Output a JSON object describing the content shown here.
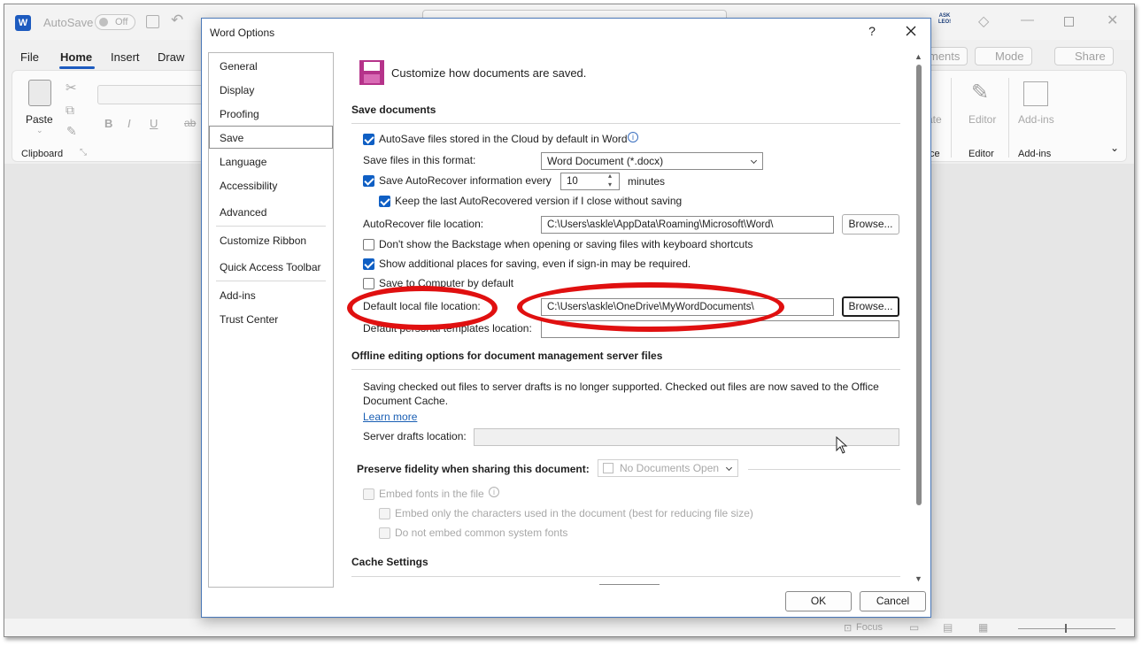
{
  "app": {
    "autosave_label": "AutoSave",
    "autosave_toggle": "Off",
    "ribbon_tabs": [
      "File",
      "Home",
      "Insert",
      "Draw"
    ],
    "active_tab": "Home",
    "clipboard": {
      "paste_label": "Paste",
      "group_label": "Clipboard"
    },
    "font_buttons": [
      "B",
      "I",
      "U",
      "ab"
    ],
    "right_buttons": {
      "comments": "ments",
      "mode": "Mode",
      "share": "Share"
    },
    "right_groups": [
      {
        "icon": "editor-icon",
        "label": "Editor",
        "group": "Editor"
      },
      {
        "icon": "addins-icon",
        "label": "Add-ins",
        "group": "Add-ins"
      }
    ],
    "partial_group": "ce",
    "partial_group_top": "ate",
    "status": {
      "focus": "Focus"
    },
    "logo_text": "ASK LEO!"
  },
  "dialog": {
    "title": "Word Options",
    "help": "?",
    "nav": [
      "General",
      "Display",
      "Proofing",
      "Save",
      "Language",
      "Accessibility",
      "Advanced",
      "Customize Ribbon",
      "Quick Access Toolbar",
      "Add-ins",
      "Trust Center"
    ],
    "selected_nav": "Save",
    "header": "Customize how documents are saved.",
    "save_section": {
      "title": "Save documents",
      "autosave_cloud": {
        "label": "AutoSave files stored in the Cloud by default in Word",
        "checked": true
      },
      "format_label": "Save files in this format:",
      "format_value": "Word Document (*.docx)",
      "autorecover": {
        "label": "Save AutoRecover information every",
        "checked": true,
        "value": "10",
        "unit": "minutes"
      },
      "keep_last": {
        "label": "Keep the last AutoRecovered version if I close without saving",
        "checked": true
      },
      "autorecover_location_label": "AutoRecover file location:",
      "autorecover_location": "C:\\Users\\askle\\AppData\\Roaming\\Microsoft\\Word\\",
      "browse": "Browse...",
      "no_backstage": {
        "label": "Don't show the Backstage when opening or saving files with keyboard shortcuts",
        "checked": false
      },
      "additional_places": {
        "label": "Show additional places for saving, even if sign-in may be required.",
        "checked": true
      },
      "save_computer": {
        "label": "Save to Computer by default",
        "checked": false
      },
      "default_local_label": "Default local file location:",
      "default_local": "C:\\Users\\askle\\OneDrive\\MyWordDocuments\\",
      "templates_label": "Default personal templates location:",
      "templates_value": ""
    },
    "offline_section": {
      "title": "Offline editing options for document management server files",
      "note": "Saving checked out files to server drafts is no longer supported. Checked out files are now saved to the Office Document Cache.",
      "learn_more": "Learn more",
      "drafts_label": "Server drafts location:",
      "drafts_value": ""
    },
    "fidelity_section": {
      "title": "Preserve fidelity when sharing this document:",
      "doc_select": "No Documents Open",
      "embed_fonts": "Embed fonts in the file",
      "embed_only": "Embed only the characters used in the document (best for reducing file size)",
      "no_common": "Do not embed common system fonts"
    },
    "cache_section": {
      "title": "Cache Settings"
    },
    "ok": "OK",
    "cancel": "Cancel"
  },
  "colors": {
    "accent": "#0f5fc4",
    "annotation": "#e01010"
  }
}
